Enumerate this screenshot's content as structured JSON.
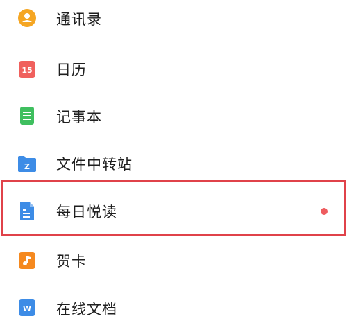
{
  "items": [
    {
      "label": "通讯录",
      "icon": "contacts-icon",
      "color": "#f5a623"
    },
    {
      "label": "日历",
      "icon": "calendar-icon",
      "color": "#f0605d",
      "badge_text": "15"
    },
    {
      "label": "记事本",
      "icon": "notepad-icon",
      "color": "#3fbf5f"
    },
    {
      "label": "文件中转站",
      "icon": "folder-z-icon",
      "color": "#3d8ce6",
      "badge_text": "Z"
    },
    {
      "label": "每日悦读",
      "icon": "daily-reading-icon",
      "color": "#3d8ce6",
      "has_red_dot": true,
      "highlighted": true
    },
    {
      "label": "贺卡",
      "icon": "greeting-card-icon",
      "color": "#f5891f"
    },
    {
      "label": "在线文档",
      "icon": "online-docs-icon",
      "color": "#3d8ce6",
      "badge_text": "W"
    }
  ],
  "highlight_color": "#e0424a",
  "red_dot_color": "#ee5c5f"
}
